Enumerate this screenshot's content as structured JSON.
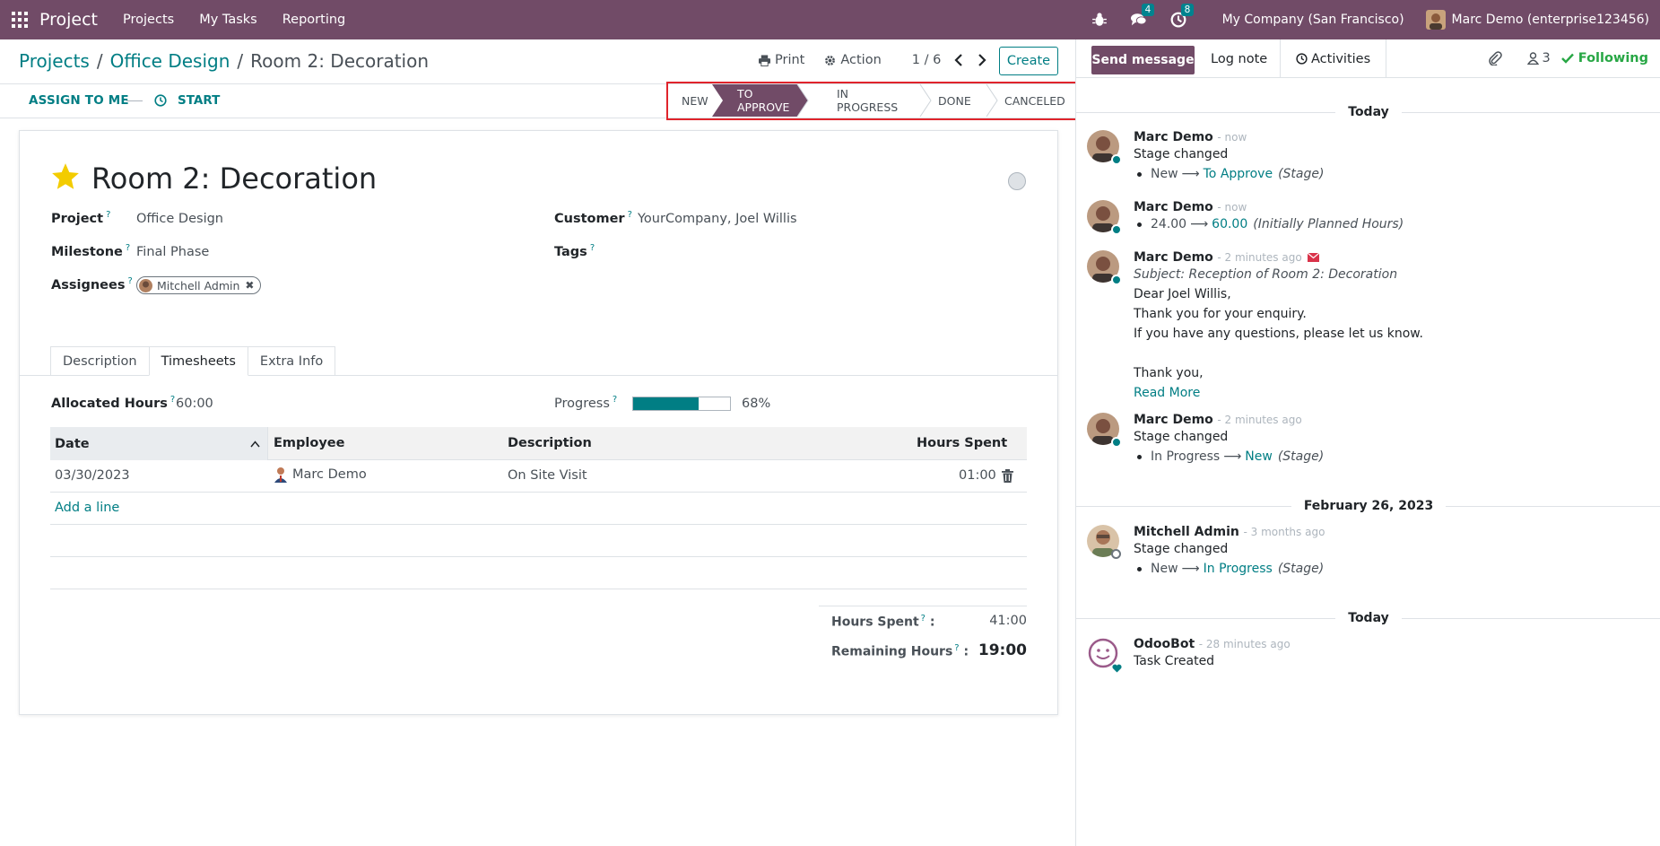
{
  "topbar": {
    "app_name": "Project",
    "menu": [
      "Projects",
      "My Tasks",
      "Reporting"
    ],
    "chat_badge": "4",
    "activity_badge": "8",
    "company": "My Company (San Francisco)",
    "user": "Marc Demo (enterprise123456)"
  },
  "breadcrumb": {
    "root": "Projects",
    "parent": "Office Design",
    "current": "Room 2: Decoration"
  },
  "control": {
    "print_label": "Print",
    "action_label": "Action",
    "pager": "1 / 6",
    "create_label": "Create"
  },
  "statusbar": {
    "assign_label": "ASSIGN TO ME",
    "start_label": "START",
    "stages": [
      "NEW",
      "TO APPROVE",
      "IN PROGRESS",
      "DONE",
      "CANCELED"
    ],
    "active_stage": "TO APPROVE"
  },
  "form": {
    "title": "Room 2: Decoration",
    "fields": {
      "project_label": "Project",
      "project_value": "Office Design",
      "milestone_label": "Milestone",
      "milestone_value": "Final Phase",
      "assignees_label": "Assignees",
      "assignee": "Mitchell Admin",
      "customer_label": "Customer",
      "customer_value": "YourCompany, Joel Willis",
      "tags_label": "Tags"
    },
    "tabs": [
      "Description",
      "Timesheets",
      "Extra Info"
    ],
    "allocated_label": "Allocated Hours",
    "allocated_value": "60:00",
    "progress_label": "Progress",
    "progress_value": "68%",
    "progress_fraction": 0.68,
    "table": {
      "headers": [
        "Date",
        "Employee",
        "Description",
        "Hours Spent"
      ],
      "rows": [
        {
          "date": "03/30/2023",
          "employee": "Marc Demo",
          "description": "On Site Visit",
          "hours": "01:00"
        }
      ],
      "add_line": "Add a line"
    },
    "totals": {
      "spent_label": "Hours Spent",
      "spent_value": "41:00",
      "remaining_label": "Remaining Hours",
      "remaining_value": "19:00"
    }
  },
  "chatter": {
    "send_message": "Send message",
    "log_note": "Log note",
    "activities": "Activities",
    "followers_count": "3",
    "following": "Following",
    "separators": [
      "Today",
      "February 26, 2023",
      "Today"
    ],
    "messages": [
      {
        "author": "Marc Demo",
        "time": "- now",
        "line": "Stage changed",
        "old": "New",
        "new": "To Approve",
        "field": "(Stage)"
      },
      {
        "author": "Marc Demo",
        "time": "- now",
        "old": "24.00",
        "new": "60.00",
        "field": "(Initially Planned Hours)"
      },
      {
        "author": "Marc Demo",
        "time": "- 2 minutes ago",
        "subject": "Subject: Reception of Room 2: Decoration",
        "lines": [
          "Dear Joel Willis,",
          "Thank you for your enquiry.",
          "If you have any questions, please let us know.",
          "Thank you,"
        ],
        "read_more": "Read More"
      },
      {
        "author": "Marc Demo",
        "time": "- 2 minutes ago",
        "line": "Stage changed",
        "old": "In Progress",
        "new": "New",
        "field": "(Stage)"
      },
      {
        "author": "Mitchell Admin",
        "time": "- 3 months ago",
        "line": "Stage changed",
        "old": "New",
        "new": "In Progress",
        "field": "(Stage)"
      },
      {
        "author": "OdooBot",
        "time": "- 28 minutes ago",
        "line": "Task Created"
      }
    ]
  },
  "colors": {
    "brand": "#714b67",
    "accent": "#017e84",
    "highlight": "#e0242c",
    "star": "#f3cc00",
    "following": "#28a745"
  }
}
